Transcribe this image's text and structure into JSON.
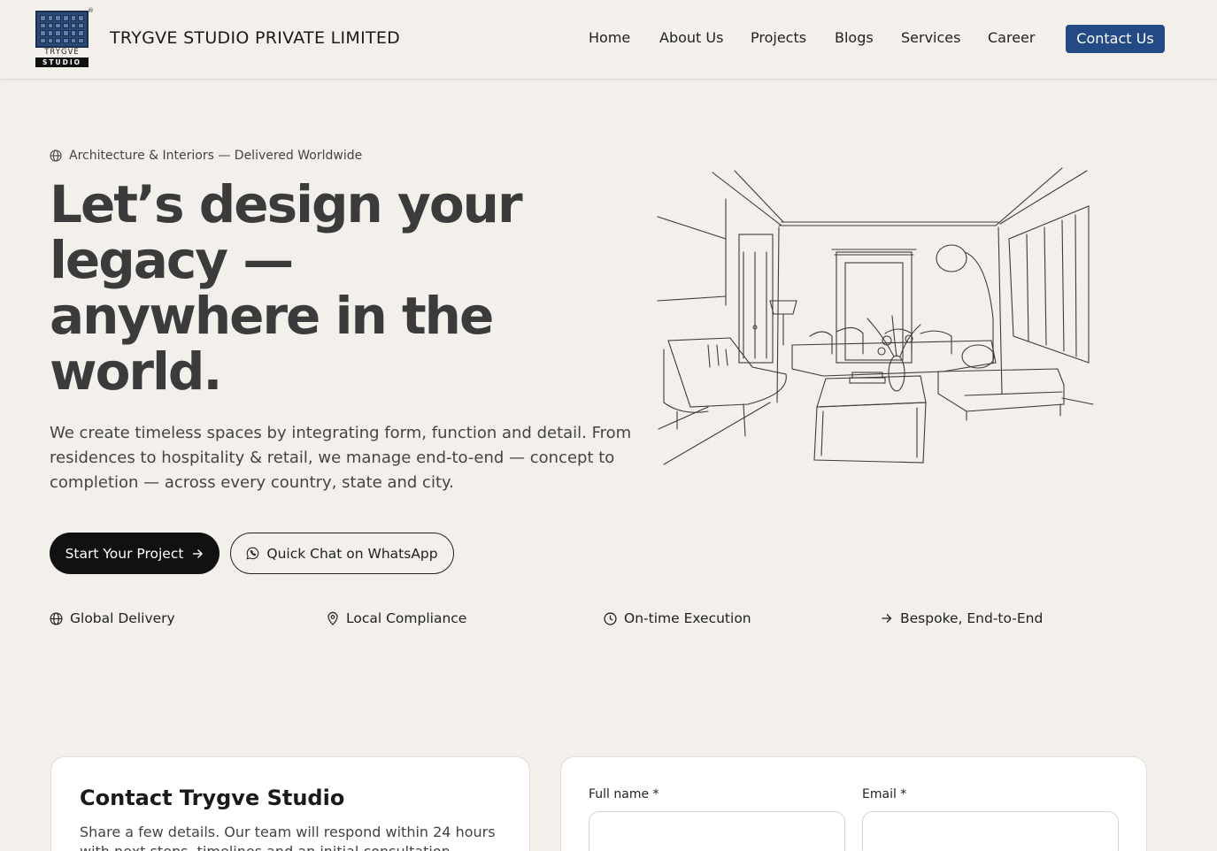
{
  "header": {
    "logo": {
      "top": "TRYGVE",
      "bottom": "STUDIO",
      "reg": "®"
    },
    "company": "TRYGVE STUDIO PRIVATE LIMITED",
    "nav": [
      "Home",
      "About Us",
      "Projects",
      "Blogs",
      "Services",
      "Career"
    ],
    "contact": "Contact Us"
  },
  "hero": {
    "eyebrow": "Architecture & Interiors — Delivered Worldwide",
    "headline_lines": [
      "Let’s design your",
      "legacy —",
      "anywhere in the",
      "world."
    ],
    "lead": "We create timeless spaces by integrating form, function and detail. From residences to hospitality & retail, we manage end-to-end — concept to completion — across every country, state and city.",
    "primary_cta": "Start Your Project",
    "secondary_cta": "Quick Chat on WhatsApp",
    "features": [
      "Global Delivery",
      "Local Compliance",
      "On-time Execution",
      "Bespoke, End-to-End"
    ]
  },
  "contact": {
    "title": "Contact Trygve Studio",
    "text": "Share a few details. Our team will respond within 24 hours with next steps, timelines and an initial consultation.",
    "fields": [
      {
        "label": "Full name *",
        "value": ""
      },
      {
        "label": "Email *",
        "value": ""
      }
    ]
  },
  "colors": {
    "background": "#f3f0eb",
    "accent": "#234a84",
    "primary_button": "#111111"
  }
}
